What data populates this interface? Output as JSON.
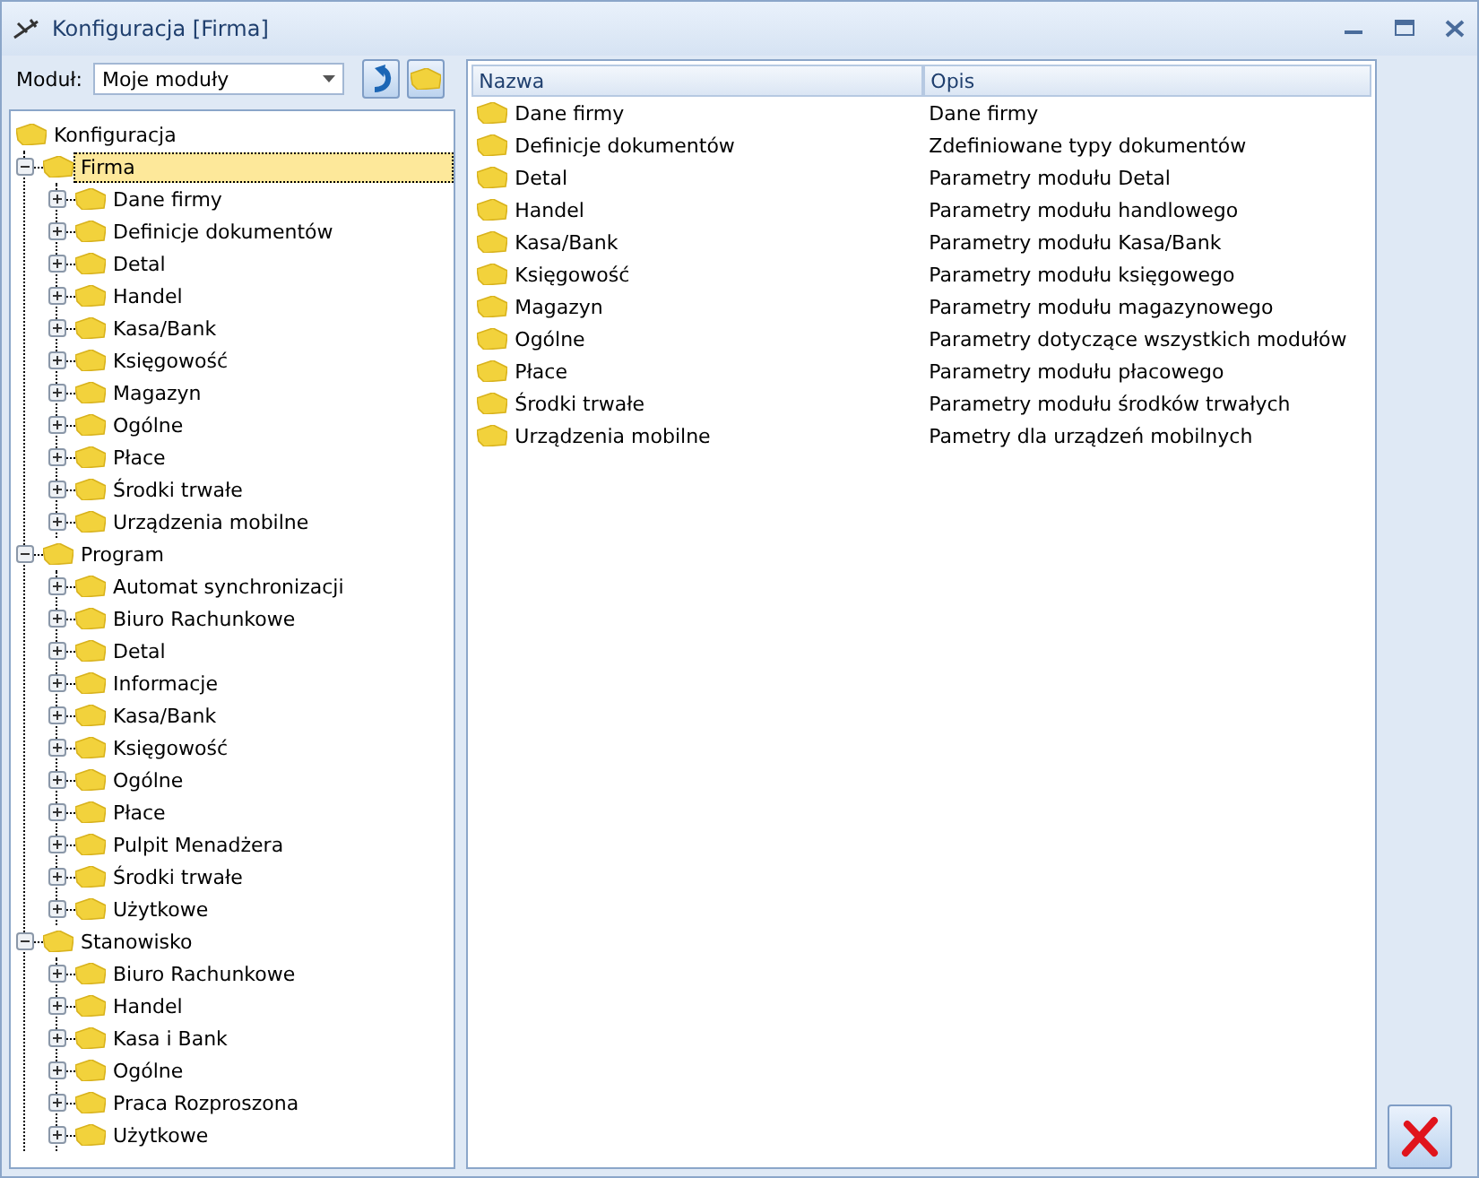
{
  "window": {
    "title": "Konfiguracja [Firma]"
  },
  "module": {
    "label": "Moduł:",
    "value": "Moje moduły"
  },
  "tree": {
    "label": "Konfiguracja",
    "selected": false,
    "children": [
      {
        "label": "Firma",
        "expanded": true,
        "selected": true,
        "children": [
          {
            "label": "Dane firmy",
            "expanded": false,
            "selected": false
          },
          {
            "label": "Definicje dokumentów",
            "expanded": false,
            "selected": false
          },
          {
            "label": "Detal",
            "expanded": false,
            "selected": false
          },
          {
            "label": "Handel",
            "expanded": false,
            "selected": false
          },
          {
            "label": "Kasa/Bank",
            "expanded": false,
            "selected": false
          },
          {
            "label": "Księgowość",
            "expanded": false,
            "selected": false
          },
          {
            "label": "Magazyn",
            "expanded": false,
            "selected": false
          },
          {
            "label": "Ogólne",
            "expanded": false,
            "selected": false
          },
          {
            "label": "Płace",
            "expanded": false,
            "selected": false
          },
          {
            "label": "Środki trwałe",
            "expanded": false,
            "selected": false
          },
          {
            "label": "Urządzenia mobilne",
            "expanded": false,
            "selected": false
          }
        ]
      },
      {
        "label": "Program",
        "expanded": true,
        "selected": false,
        "children": [
          {
            "label": "Automat synchronizacji",
            "expanded": false,
            "selected": false
          },
          {
            "label": "Biuro Rachunkowe",
            "expanded": false,
            "selected": false
          },
          {
            "label": "Detal",
            "expanded": false,
            "selected": false
          },
          {
            "label": "Informacje",
            "expanded": false,
            "selected": false
          },
          {
            "label": "Kasa/Bank",
            "expanded": false,
            "selected": false
          },
          {
            "label": "Księgowość",
            "expanded": false,
            "selected": false
          },
          {
            "label": "Ogólne",
            "expanded": false,
            "selected": false
          },
          {
            "label": "Płace",
            "expanded": false,
            "selected": false
          },
          {
            "label": "Pulpit Menadżera",
            "expanded": false,
            "selected": false
          },
          {
            "label": "Środki trwałe",
            "expanded": false,
            "selected": false
          },
          {
            "label": "Użytkowe",
            "expanded": false,
            "selected": false
          }
        ]
      },
      {
        "label": "Stanowisko",
        "expanded": true,
        "selected": false,
        "children": [
          {
            "label": "Biuro Rachunkowe",
            "expanded": false,
            "selected": false
          },
          {
            "label": "Handel",
            "expanded": false,
            "selected": false
          },
          {
            "label": "Kasa i Bank",
            "expanded": false,
            "selected": false
          },
          {
            "label": "Ogólne",
            "expanded": false,
            "selected": false
          },
          {
            "label": "Praca Rozproszona",
            "expanded": false,
            "selected": false
          },
          {
            "label": "Użytkowe",
            "expanded": false,
            "selected": false
          }
        ]
      }
    ]
  },
  "table": {
    "columns": [
      "Nazwa",
      "Opis"
    ],
    "rows": [
      [
        "Dane firmy",
        "Dane firmy"
      ],
      [
        "Definicje dokumentów",
        "Zdefiniowane typy dokumentów"
      ],
      [
        "Detal",
        "Parametry modułu Detal"
      ],
      [
        "Handel",
        "Parametry modułu handlowego"
      ],
      [
        "Kasa/Bank",
        "Parametry modułu Kasa/Bank"
      ],
      [
        "Księgowość",
        "Parametry modułu księgowego"
      ],
      [
        "Magazyn",
        "Parametry modułu magazynowego"
      ],
      [
        "Ogólne",
        "Parametry dotyczące wszystkich modułów"
      ],
      [
        "Płace",
        "Parametry modułu płacowego"
      ],
      [
        "Środki trwałe",
        "Parametry modułu środków trwałych"
      ],
      [
        "Urządzenia mobilne",
        "Pametry dla urządzeń mobilnych"
      ]
    ]
  }
}
